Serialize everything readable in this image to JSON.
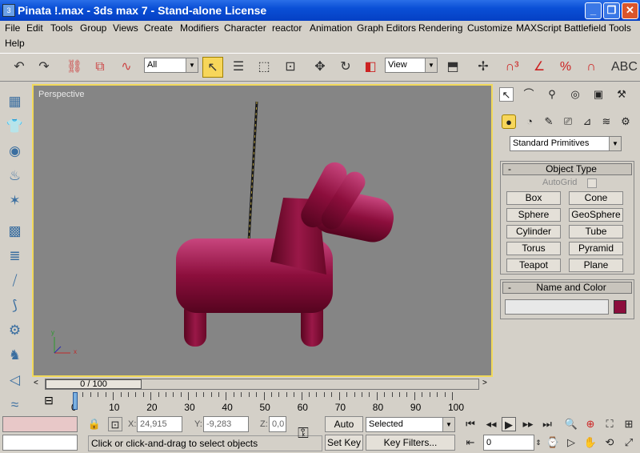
{
  "window": {
    "title": "Pinata !.max - 3ds max 7  - Stand-alone License",
    "minimize": "_",
    "maximize": "❐",
    "close": "✕"
  },
  "menu": [
    "File",
    "Edit",
    "Tools",
    "Group",
    "Views",
    "Create",
    "Modifiers",
    "Character",
    "reactor",
    "Animation",
    "Graph Editors",
    "Rendering",
    "Customize",
    "MAXScript",
    "Battlefield Tools",
    "Help"
  ],
  "toolbar": {
    "selection_filter": "All",
    "ref_coord": "View"
  },
  "viewport": {
    "label": "Perspective"
  },
  "time_slider": {
    "position": "0 / 100",
    "current": 0,
    "total": 100
  },
  "ruler": {
    "labels": [
      "0",
      "10",
      "20",
      "30",
      "40",
      "50",
      "60",
      "70",
      "80",
      "90",
      "100"
    ]
  },
  "command_panel": {
    "category": "Standard Primitives",
    "object_type": {
      "title": "Object Type",
      "autogrid": "AutoGrid",
      "buttons": [
        "Box",
        "Cone",
        "Sphere",
        "GeoSphere",
        "Cylinder",
        "Tube",
        "Torus",
        "Pyramid",
        "Teapot",
        "Plane"
      ]
    },
    "name_color": {
      "title": "Name and Color",
      "name_value": "",
      "color": "#8c0e3c"
    }
  },
  "status": {
    "prompt": "Click or click-and-drag to select objects",
    "x_label": "X:",
    "x": "24,915",
    "y_label": "Y:",
    "y": "-9,283",
    "z_label": "Z:",
    "z": "0,0",
    "auto_key": "Auto Key",
    "set_key": "Set Key",
    "key_mode": "Selected",
    "key_filters": "Key Filters...",
    "frame": "0"
  },
  "colors": {
    "viewport_bg": "#858585",
    "viewport_border": "#f1d95a",
    "pinata": "#8c0e3c",
    "titlebar": "#0a4fd6"
  }
}
